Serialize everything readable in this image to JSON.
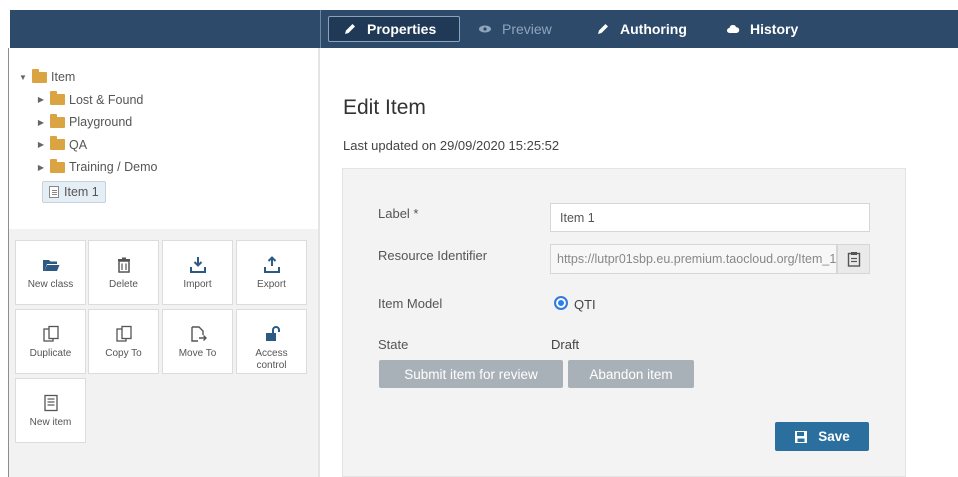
{
  "nav": {
    "tabs": [
      {
        "label": "Properties",
        "icon": "pencil-icon",
        "state": "active"
      },
      {
        "label": "Preview",
        "icon": "eye-icon",
        "state": "disabled"
      },
      {
        "label": "Authoring",
        "icon": "pencil-icon",
        "state": "normal"
      },
      {
        "label": "History",
        "icon": "cloud-icon",
        "state": "normal"
      }
    ]
  },
  "tree": {
    "root": "Item",
    "folders": [
      "Lost & Found",
      "Playground",
      "QA",
      "Training / Demo"
    ],
    "selected_item": "Item 1"
  },
  "actions": [
    {
      "label": "New class",
      "icon": "folder-open-icon"
    },
    {
      "label": "Delete",
      "icon": "trash-icon"
    },
    {
      "label": "Import",
      "icon": "import-icon"
    },
    {
      "label": "Export",
      "icon": "export-icon"
    },
    {
      "label": "Duplicate",
      "icon": "duplicate-icon"
    },
    {
      "label": "Copy To",
      "icon": "copy-icon"
    },
    {
      "label": "Move To",
      "icon": "move-icon"
    },
    {
      "label": "Access control",
      "icon": "unlock-icon"
    },
    {
      "label": "New item",
      "icon": "document-icon"
    }
  ],
  "main": {
    "title": "Edit Item",
    "last_updated": "Last updated on 29/09/2020 15:25:52",
    "form": {
      "label_field": {
        "label": "Label *",
        "value": "Item 1"
      },
      "resource_identifier": {
        "label": "Resource Identifier",
        "value": "https://lutpr01sbp.eu.premium.taocloud.org/Item_1"
      },
      "item_model": {
        "label": "Item Model",
        "option": "QTI"
      },
      "state": {
        "label": "State",
        "value": "Draft"
      }
    },
    "buttons": {
      "submit": "Submit item for review",
      "abandon": "Abandon item",
      "save": "Save"
    }
  },
  "colors": {
    "topbar": "#2d4a6a",
    "save_button": "#2b6f9f",
    "gray_button": "#a9b1b8",
    "folder": "#d9a441",
    "radio": "#2f7de1"
  }
}
